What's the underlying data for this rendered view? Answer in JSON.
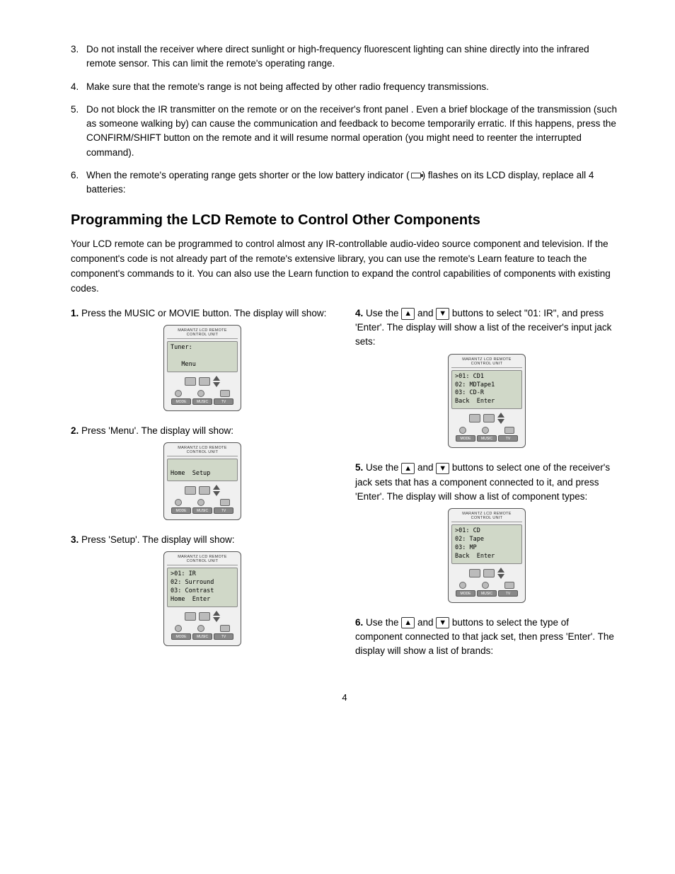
{
  "page": {
    "number": "4",
    "bullets_intro": [
      {
        "num": "3.",
        "text": "Do not install the receiver where direct sunlight or high-frequency fluorescent lighting can shine directly into the infrared remote sensor. This can limit the remote's operating range."
      },
      {
        "num": "4.",
        "text": "Make sure that the remote's range is not being affected by other radio frequency transmissions."
      },
      {
        "num": "5.",
        "text": "Do not block the IR transmitter on the remote or on the receiver's front panel . Even a brief blockage of the transmission (such as someone walking by) can cause the communication and feedback to become temporarily erratic. If this happens, press the CONFIRM/SHIFT button on the remote and it will resume normal operation (you might need to reenter the interrupted command)."
      },
      {
        "num": "6.",
        "text_pre": "When the remote's operating range gets shorter or the low battery indicator (",
        "text_post": ") flashes on its LCD display, replace all 4 batteries:"
      }
    ],
    "section_title": "Programming the LCD Remote to Control Other Components",
    "intro": "Your LCD remote can be programmed to control almost any IR-controllable audio-video source component and television. If the component's code is not already part of the remote's extensive library, you can use the remote's Learn feature to teach the component's commands to it. You can also use the Learn function to expand the control capabilities of components with existing codes.",
    "left_steps": [
      {
        "num": "1.",
        "text": "Press the MUSIC or MOVIE button. The display will show:",
        "display_lines": [
          "Tuner:",
          "",
          "Menu"
        ]
      },
      {
        "num": "2.",
        "text": "Press 'Menu'. The display will show:",
        "display_lines": [
          "Home  Setup"
        ]
      },
      {
        "num": "3.",
        "text": "Press 'Setup'. The display will show:",
        "display_lines": [
          ">01: IR",
          "02: Surround",
          "03: Contrast",
          "Home  Enter"
        ]
      }
    ],
    "right_steps": [
      {
        "num": "4.",
        "text_pre": "Use the",
        "text_mid": "and",
        "text_post": "buttons to select \"01: IR\", and press 'Enter'. The display will show a list of the receiver's input jack sets:",
        "display_lines": [
          ">01: CD1",
          "02: MDTape1",
          "03: CD-R",
          "Back  Enter"
        ]
      },
      {
        "num": "5.",
        "text_pre": "Use the",
        "text_mid": "and",
        "text_post": "buttons to select one of the receiver's jack sets that has a component connected to it, and press 'Enter'. The display will show a list of component types:",
        "display_lines": [
          ">01: CD",
          "02: Tape",
          "03: MP",
          "Back  Enter"
        ]
      },
      {
        "num": "6.",
        "text_pre": "Use the",
        "text_mid": "and",
        "text_post": "buttons to select the type of component connected to that jack set, then press 'Enter'. The display will show a list of brands:"
      }
    ]
  }
}
